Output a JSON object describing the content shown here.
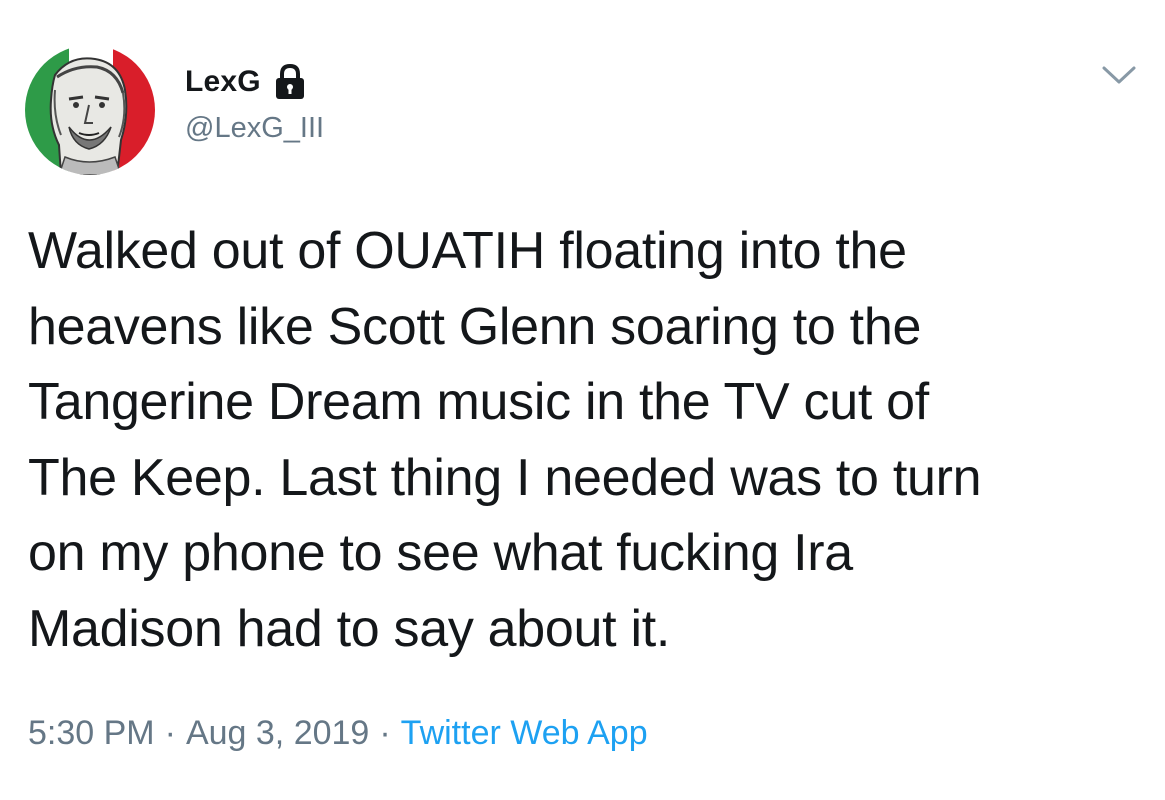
{
  "author": {
    "display_name": "LexG",
    "handle": "@LexG_III",
    "avatar_icon": "avatar-sketch-portrait-italian-flag",
    "locked_icon": "lock-icon"
  },
  "tweet": {
    "text": "Walked out of OUATIH floating into the\nheavens like Scott Glenn soaring to the\nTangerine Dream music in the TV cut of\nThe Keep.  Last thing I needed was to turn\non my phone to see what fucking Ira\nMadison had to say about it."
  },
  "meta": {
    "time": "5:30 PM",
    "separator": "·",
    "date": "Aug 3, 2019",
    "source": "Twitter Web App"
  },
  "colors": {
    "text": "#14171a",
    "secondary": "#657786",
    "link": "#1da1f2",
    "flag_green": "#2e9b48",
    "flag_red": "#d91e2a"
  },
  "menu": {
    "icon": "chevron-down-icon"
  }
}
